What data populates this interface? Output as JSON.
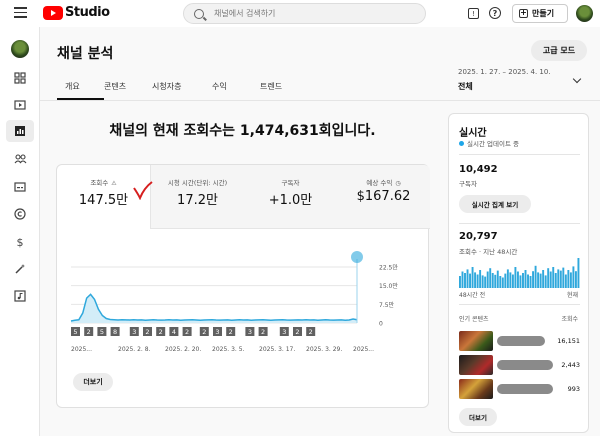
{
  "app": {
    "logo_text": "Studio",
    "search_placeholder": "채널에서 검색하기",
    "create_label": "만들기"
  },
  "page": {
    "title": "채널 분석",
    "advanced_mode": "고급 모드",
    "tabs": [
      {
        "label": "개요",
        "active": true
      },
      {
        "label": "콘텐츠",
        "active": false
      },
      {
        "label": "시청자층",
        "active": false
      },
      {
        "label": "수익",
        "active": false
      },
      {
        "label": "트렌드",
        "active": false
      }
    ],
    "date_range": "2025. 1. 27. – 2025. 4. 10.",
    "period_label": "전체"
  },
  "overview": {
    "headline": "채널의 현재 조회수는 1,474,631회입니다.",
    "metrics": [
      {
        "label": "조회수",
        "value": "147.5만",
        "warning_icon": true
      },
      {
        "label": "시청 시간(단위: 시간)",
        "value": "17.2만"
      },
      {
        "label": "구독자",
        "value": "+1.0만"
      },
      {
        "label": "예상 수익",
        "value": "$167.62",
        "clock_icon": true
      }
    ],
    "more_label": "더보기"
  },
  "chart_data": {
    "type": "line",
    "x_tick_labels": [
      "2025...",
      "2025. 2. 8.",
      "2025. 2. 20.",
      "2025. 3. 5.",
      "2025. 3. 17.",
      "2025. 3. 29.",
      "2025..."
    ],
    "y_tick_labels": [
      "22.5만",
      "15.0만",
      "7.5만",
      "0"
    ],
    "ylim": [
      0,
      225000
    ],
    "series": [
      {
        "values": [
          8000,
          11000,
          13000,
          40000,
          100000,
          115000,
          95000,
          55000,
          30000,
          18000,
          14000,
          13000,
          12000,
          13000,
          12500,
          12000,
          13000,
          12000,
          12500,
          11000,
          12000,
          13000,
          12000,
          11500,
          12000,
          13000,
          12000,
          12500,
          11000,
          12000,
          12500,
          13000,
          12000,
          11000,
          12000,
          12500,
          13000,
          12000,
          11500,
          12000,
          12500,
          11000,
          12000,
          13000,
          12000,
          12500,
          11000,
          12000,
          12500,
          13000,
          12000,
          11000,
          12000,
          12500,
          13000,
          12000,
          11500,
          12000,
          12500,
          12000,
          13000,
          12000,
          12500,
          11000,
          12000,
          13000,
          12000,
          11500,
          12000,
          12500,
          11000,
          12000,
          16000,
          13000
        ]
      }
    ],
    "video_markers": [
      "5",
      "2",
      "5",
      "8",
      "3",
      "2",
      "2",
      "4",
      "2",
      "2",
      "3",
      "2",
      "3",
      "2",
      "3",
      "2",
      "2"
    ],
    "colors": {
      "line": "#2fa8dc",
      "fill": "#d3edf8"
    }
  },
  "realtime": {
    "title": "실시간",
    "live_text": "실시간 업데이트 중",
    "subscribers": "10,492",
    "subscribers_label": "구독자",
    "button": "실시간 집계 보기",
    "views": "20,797",
    "views_label": "조회수 · 지난 48시간",
    "axis_left": "48시간 전",
    "axis_right": "현재",
    "top_content_label": "인기 콘텐츠",
    "views_col_label": "조회수",
    "videos": [
      {
        "views": "16,151"
      },
      {
        "views": "2,443"
      },
      {
        "views": "993"
      }
    ],
    "bars": [
      40,
      55,
      50,
      62,
      48,
      70,
      52,
      45,
      60,
      42,
      38,
      55,
      66,
      50,
      44,
      58,
      40,
      35,
      48,
      62,
      52,
      45,
      70,
      55,
      42,
      50,
      60,
      45,
      40,
      56,
      74,
      52,
      48,
      60,
      42,
      66,
      55,
      70,
      50,
      62,
      58,
      68,
      45,
      60,
      52,
      72,
      56,
      100
    ],
    "more_label": "더보기"
  }
}
